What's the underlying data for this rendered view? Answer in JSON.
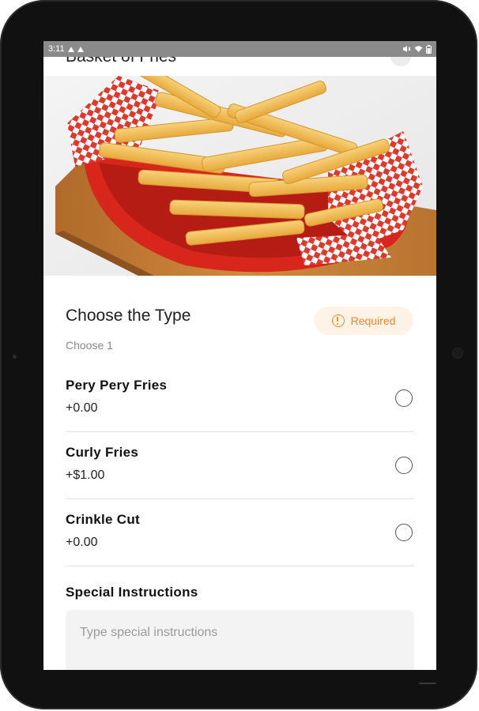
{
  "status_bar": {
    "time": "3:11"
  },
  "app_bar": {
    "title": "Basket of Fries"
  },
  "hero": {
    "alt": "Crinkle cut fries in a red basket"
  },
  "choice_group": {
    "title": "Choose the Type",
    "subtitle": "Choose 1",
    "required_label": "Required",
    "options": [
      {
        "name": "Pery Pery Fries",
        "price": "+0.00"
      },
      {
        "name": "Curly Fries",
        "price": "+$1.00"
      },
      {
        "name": "Crinkle Cut",
        "price": "+0.00"
      }
    ]
  },
  "special_instructions": {
    "title": "Special Instructions",
    "placeholder": "Type special instructions"
  },
  "colors": {
    "accent": "#f08a24",
    "accent_bg": "#fff3e8",
    "basket_red": "#d8261c"
  }
}
